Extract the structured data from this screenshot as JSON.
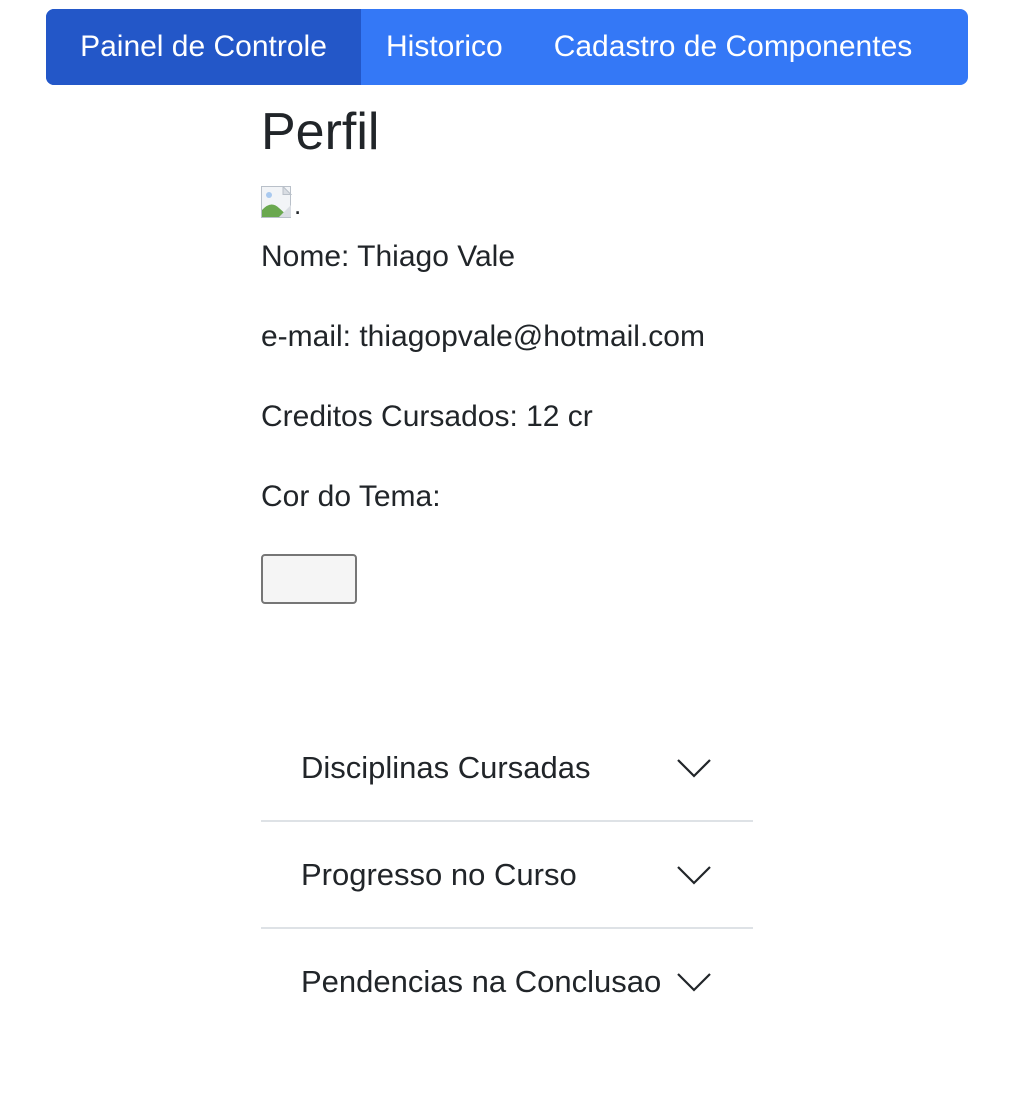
{
  "nav": {
    "items": [
      {
        "label": "Painel de Controle",
        "active": true
      },
      {
        "label": "Historico",
        "active": false
      },
      {
        "label": "Cadastro de Componentes",
        "active": false
      }
    ]
  },
  "profile": {
    "title": "Perfil",
    "avatar_alt": ".",
    "name_line": "Nome: Thiago Vale",
    "email_line": "e-mail: thiagopvale@hotmail.com",
    "credits_line": "Creditos Cursados: 12 cr",
    "theme_label": "Cor do Tema:"
  },
  "accordion": {
    "items": [
      {
        "label": "Disciplinas Cursadas"
      },
      {
        "label": "Progresso no Curso"
      },
      {
        "label": "Pendencias na Conclusao"
      }
    ]
  },
  "colors": {
    "nav_bg": "#3478f6",
    "nav_active_bg": "#2357c8",
    "text": "#212529"
  }
}
